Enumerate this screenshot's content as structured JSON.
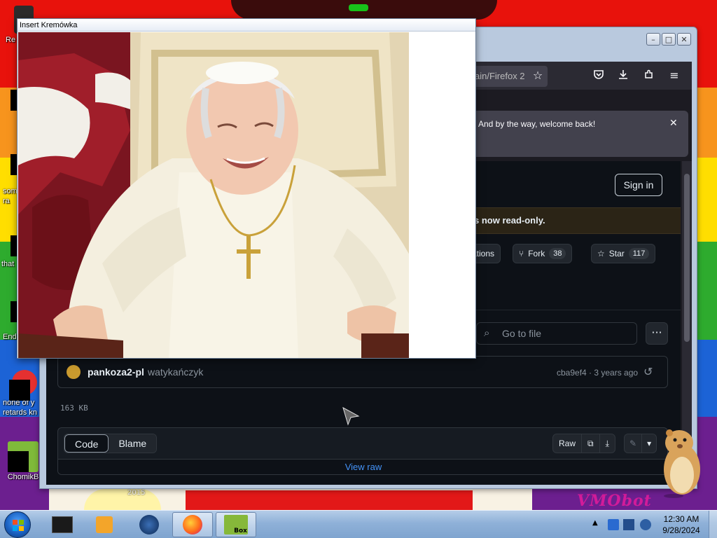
{
  "popup": {
    "title": "Insert Kremówka"
  },
  "desktop": {
    "icons": [
      {
        "label": "Re"
      },
      {
        "label": "som\nra"
      },
      {
        "label": "that"
      },
      {
        "label": "End"
      },
      {
        "label": "none of y\nretards kn"
      },
      {
        "label": "ChomikB"
      }
    ],
    "wallpaper_text": "VMObot",
    "year_text": "2015"
  },
  "firefox": {
    "url_fragment": "ain/Firefox 2",
    "notification": "And by the way, welcome back!",
    "github": {
      "sign_in": "Sign in",
      "banner": "s now read-only.",
      "notifications_label": "ations",
      "fork_label": "Fork",
      "fork_count": "38",
      "star_label": "Star",
      "star_count": "117",
      "go_to_file": "Go to file",
      "commit_author": "pankoza2-pl",
      "commit_message": "watykańczyk",
      "commit_meta": "cba9ef4 · 3 years ago",
      "file_size": "163 KB",
      "code_tab": "Code",
      "blame_tab": "Blame",
      "raw_button": "Raw",
      "view_raw": "View raw"
    }
  },
  "taskbar": {
    "time": "12:30 AM",
    "date": "9/28/2024",
    "box_label": "Box"
  },
  "colors": {
    "taskbar_top": "#b5cde8",
    "github_bg": "#0d1117",
    "link_blue": "#4493f8"
  }
}
